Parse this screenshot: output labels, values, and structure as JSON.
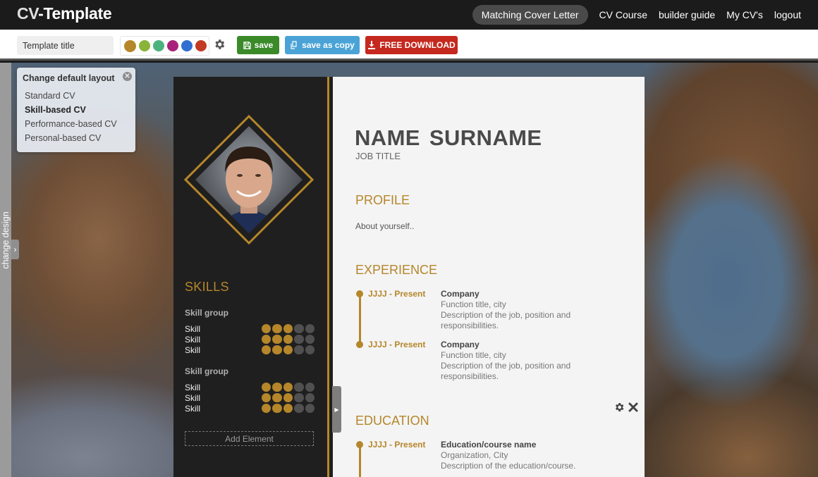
{
  "app": {
    "logo_cv": "CV",
    "logo_rest": "-Template"
  },
  "nav": {
    "items": [
      {
        "label": "Matching Cover Letter",
        "highlighted": true
      },
      {
        "label": "CV Course"
      },
      {
        "label": "builder guide"
      },
      {
        "label": "My CV's"
      },
      {
        "label": "logout"
      }
    ]
  },
  "toolbar": {
    "title_value": "Template title",
    "palette": [
      "#b5862a",
      "#8ab33a",
      "#4cb37f",
      "#a8227a",
      "#2f6fd0",
      "#c23a22"
    ],
    "settings_icon": "gear-icon",
    "save_label": "save",
    "save_copy_label": "save as copy",
    "download_label": "FREE DOWNLOAD",
    "colors": {
      "save": "#3a8a2a",
      "copy": "#4aa3d6",
      "download": "#c5281e"
    }
  },
  "sidebar": {
    "change_design_label": "change design"
  },
  "layout_popup": {
    "title": "Change default layout",
    "options": [
      {
        "label": "Standard CV",
        "active": false
      },
      {
        "label": "Skill-based CV",
        "active": true
      },
      {
        "label": "Performance-based CV",
        "active": false
      },
      {
        "label": "Personal-based CV",
        "active": false
      }
    ]
  },
  "cv": {
    "accent": "#b5862a",
    "name": "NAME  SURNAME",
    "job_title": "JOB TITLE",
    "profile": {
      "title": "PROFILE",
      "text": "About yourself.."
    },
    "skills": {
      "title": "SKILLS",
      "groups": [
        {
          "name": "Skill group",
          "skills": [
            {
              "label": "Skill",
              "level": 3,
              "max": 5
            },
            {
              "label": "Skill",
              "level": 3,
              "max": 5
            },
            {
              "label": "Skill",
              "level": 3,
              "max": 5
            }
          ]
        },
        {
          "name": "Skill group",
          "skills": [
            {
              "label": "Skill",
              "level": 3,
              "max": 5
            },
            {
              "label": "Skill",
              "level": 3,
              "max": 5
            },
            {
              "label": "Skill",
              "level": 3,
              "max": 5
            }
          ]
        }
      ],
      "add_element_label": "Add Element"
    },
    "experience": {
      "title": "EXPERIENCE",
      "items": [
        {
          "date": "JJJJ - Present",
          "head": "Company",
          "sub": "Function title, city",
          "desc": "Description of the job, position and responsibilities."
        },
        {
          "date": "JJJJ - Present",
          "head": "Company",
          "sub": "Function title, city",
          "desc": "Description of the job, position and responsibilities."
        }
      ]
    },
    "education": {
      "title": "EDUCATION",
      "items": [
        {
          "date": "JJJJ - Present",
          "head": "Education/course name",
          "sub": "Organization, City",
          "desc": "Description of the education/course."
        }
      ]
    }
  }
}
